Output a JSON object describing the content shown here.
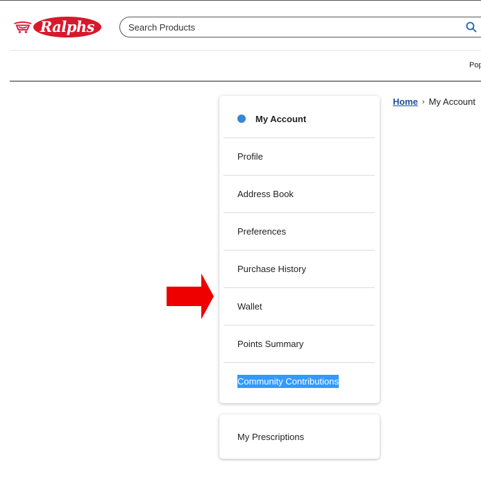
{
  "header": {
    "logo_text": "Ralphs",
    "search": {
      "placeholder": "Search Products",
      "value": ""
    },
    "nav_partial_label": "Pop"
  },
  "breadcrumb": {
    "home_label": "Home",
    "separator": "›",
    "current_label": "My Account"
  },
  "account_menu": {
    "heading": "My Account",
    "items": [
      {
        "label": "Profile"
      },
      {
        "label": "Address Book"
      },
      {
        "label": "Preferences"
      },
      {
        "label": "Purchase History"
      },
      {
        "label": "Wallet"
      },
      {
        "label": "Points Summary"
      },
      {
        "label": "Community Contributions",
        "highlighted": true
      }
    ]
  },
  "prescriptions_menu": {
    "items": [
      {
        "label": "My Prescriptions"
      }
    ]
  },
  "colors": {
    "brand_red": "#d8182b",
    "dot_blue": "#3a86d6",
    "selection_blue": "#3399ff",
    "arrow_red": "#ee0000",
    "link_blue": "#1a4fa0"
  },
  "icons": {
    "logo": "shopping-cart-icon",
    "search": "magnifier-icon",
    "annotation": "right-arrow-icon"
  }
}
